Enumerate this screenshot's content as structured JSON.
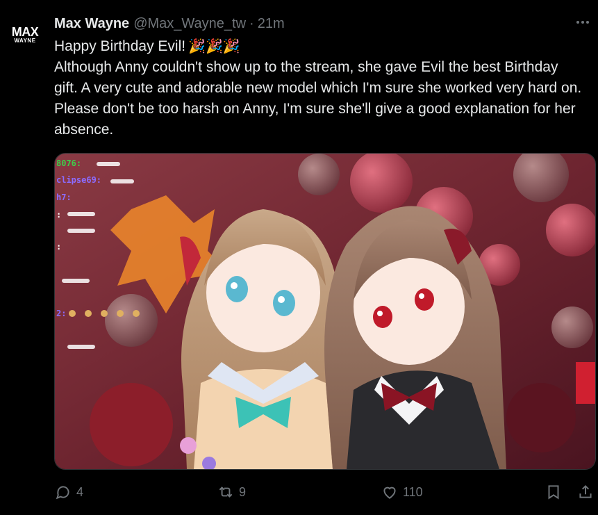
{
  "account": {
    "logo_top": "MAX",
    "logo_bottom": "WAYNE",
    "display_name": "Max Wayne",
    "handle": "@Max_Wayne_tw",
    "separator": "·",
    "time": "21m"
  },
  "tweet": {
    "line1": "Happy Birthday Evil!",
    "line1_emoji": "🎉🎉🎉",
    "body": "Although Anny couldn't show up to the stream, she gave Evil the best Birthday gift. A very cute and adorable new model which I'm sure she worked very hard on. Please don't be too harsh on Anny, I'm sure she'll give a good explanation for her absence."
  },
  "media": {
    "chat_lines": [
      "8076:",
      "clipse69:",
      "h7:",
      ":",
      ":",
      "2:"
    ]
  },
  "actions": {
    "reply_count": "4",
    "retweet_count": "9",
    "like_count": "110"
  },
  "colors": {
    "background": "#000000",
    "text": "#e7e9ea",
    "muted": "#71767b",
    "chat_green": "#3ecf4a",
    "chat_purple": "#8c6cff"
  },
  "icons": [
    "more-icon",
    "reply-icon",
    "retweet-icon",
    "like-icon",
    "bookmark-icon",
    "share-icon"
  ]
}
